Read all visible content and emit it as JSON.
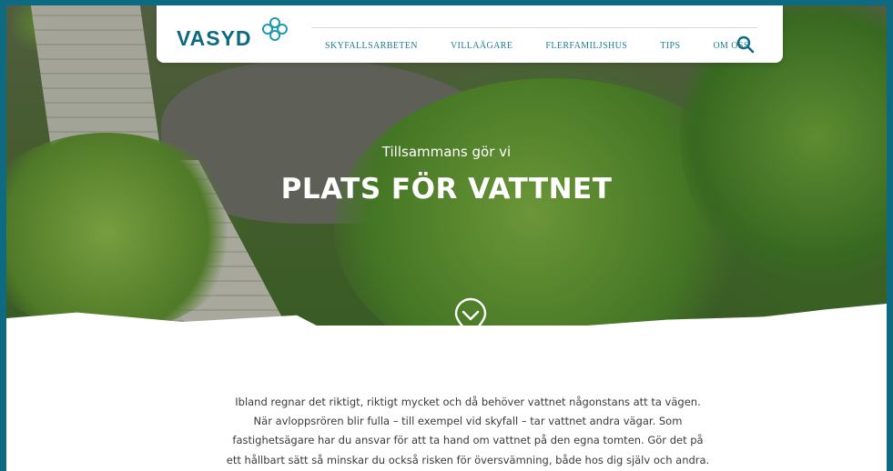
{
  "brand": {
    "logo_text": "VASYD",
    "primary_color": "#0e6a80",
    "accent_color": "#1d7c93"
  },
  "nav": {
    "items": [
      {
        "label": "SKYFALLSARBETEN"
      },
      {
        "label": "VILLAÄGARE"
      },
      {
        "label": "FLERFAMILJSHUS"
      },
      {
        "label": "TIPS"
      },
      {
        "label": "OM OSS"
      }
    ],
    "search_icon": "search-icon"
  },
  "hero": {
    "eyebrow": "Tillsammans gör vi",
    "title": "PLATS FÖR VATTNET",
    "scroll_icon": "chevron-down-icon"
  },
  "intro": {
    "text": "Ibland regnar det riktigt, riktigt mycket och då behöver vattnet någonstans att ta vägen. När avloppsrören blir fulla – till exempel vid skyfall – tar vattnet andra vägar. Som fastighetsägare har du ansvar för att ta hand om vattnet på den egna tomten. Gör det på ett hållbart sätt så minskar du också risken för översvämning, både hos dig själv och andra. Hur mycket vatten får plats hos dig?"
  }
}
